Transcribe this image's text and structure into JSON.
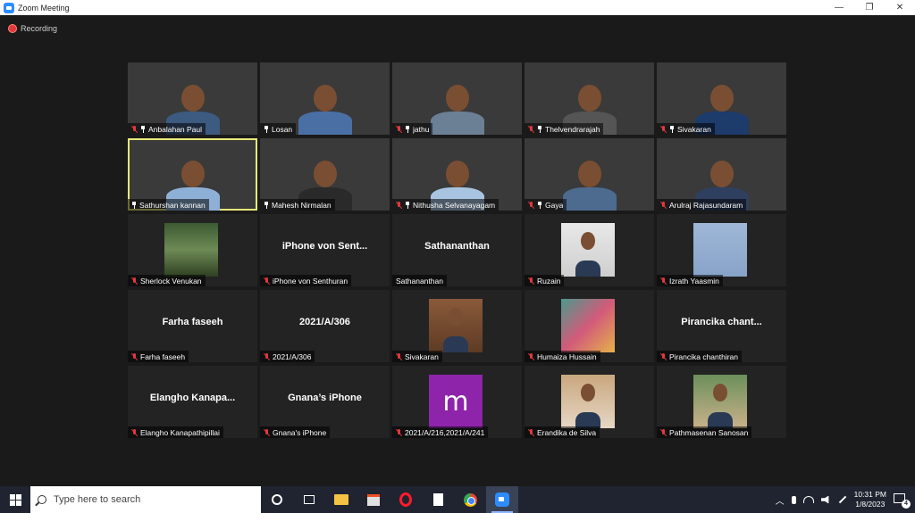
{
  "window": {
    "title": "Zoom Meeting",
    "minimize": "—",
    "restore": "❐",
    "close": "✕"
  },
  "recording": {
    "label": "Recording"
  },
  "participants": [
    {
      "name": "Anbalahan Paul",
      "display": "",
      "muted": true,
      "pinned": true,
      "video": true,
      "bg": "bg-1"
    },
    {
      "name": "Losan",
      "display": "",
      "muted": false,
      "pinned": true,
      "video": true,
      "bg": "bg-2"
    },
    {
      "name": "jathu",
      "display": "",
      "muted": true,
      "pinned": true,
      "video": true,
      "bg": "bg-3"
    },
    {
      "name": "Thelvendrarajah",
      "display": "",
      "muted": true,
      "pinned": true,
      "video": true,
      "bg": "bg-4"
    },
    {
      "name": "Sivakaran",
      "display": "",
      "muted": true,
      "pinned": true,
      "video": true,
      "bg": "bg-5"
    },
    {
      "name": "Sathurshan kannan",
      "display": "",
      "muted": false,
      "pinned": true,
      "video": true,
      "bg": "bg-6",
      "active": true
    },
    {
      "name": "Mahesh Nirmalan",
      "display": "",
      "muted": false,
      "pinned": true,
      "video": true,
      "bg": "bg-7"
    },
    {
      "name": "Nithusha Selvanayagam",
      "display": "",
      "muted": true,
      "pinned": true,
      "video": true,
      "bg": "bg-8"
    },
    {
      "name": "Gaya",
      "display": "",
      "muted": true,
      "pinned": true,
      "video": true,
      "bg": "bg-9"
    },
    {
      "name": "Arulraj Rajasundaram",
      "display": "",
      "muted": true,
      "pinned": false,
      "video": true,
      "bg": "bg-10"
    },
    {
      "name": "Sherlock Venukan",
      "display": "",
      "muted": true,
      "pinned": false,
      "photo": "tree"
    },
    {
      "name": "iPhone von Senthuran",
      "display": "iPhone von Sent...",
      "muted": true,
      "pinned": false
    },
    {
      "name": "Sathananthan",
      "display": "Sathananthan",
      "muted": false,
      "pinned": false
    },
    {
      "name": "Ruzain",
      "display": "",
      "muted": true,
      "pinned": false,
      "photo": "person-dark"
    },
    {
      "name": "Izrath Yaasmin",
      "display": "",
      "muted": true,
      "pinned": false,
      "photo": "blue-card"
    },
    {
      "name": "Farha faseeh",
      "display": "Farha faseeh",
      "muted": true,
      "pinned": false
    },
    {
      "name": "2021/A/306",
      "display": "2021/A/306",
      "muted": true,
      "pinned": false
    },
    {
      "name": "Sivakaran",
      "display": "",
      "muted": true,
      "pinned": false,
      "photo": "graduate"
    },
    {
      "name": "Humaiza Hussain",
      "display": "",
      "muted": true,
      "pinned": false,
      "photo": "art"
    },
    {
      "name": "Pirancika chanthiran",
      "display": "Pirancika  chant...",
      "muted": true,
      "pinned": false
    },
    {
      "name": "Elangho Kanapathipillai",
      "display": "Elangho  Kanapa...",
      "muted": true,
      "pinned": false
    },
    {
      "name": "Gnana's iPhone",
      "display": "Gnana’s iPhone",
      "muted": true,
      "pinned": false
    },
    {
      "name": "2021/A/216,2021/A/241",
      "display": "",
      "muted": true,
      "pinned": false,
      "photo": "m-logo",
      "logo_letter": "m"
    },
    {
      "name": "Erandika de Silva",
      "display": "",
      "muted": true,
      "pinned": false,
      "photo": "person-light"
    },
    {
      "name": "Pathmasenan Sanosan",
      "display": "",
      "muted": true,
      "pinned": false,
      "photo": "person-outdoor"
    }
  ],
  "taskbar": {
    "search_placeholder": "Type here to search",
    "time": "10:31 PM",
    "date": "1/8/2023",
    "notification_count": "4",
    "tray_up": "︿"
  }
}
